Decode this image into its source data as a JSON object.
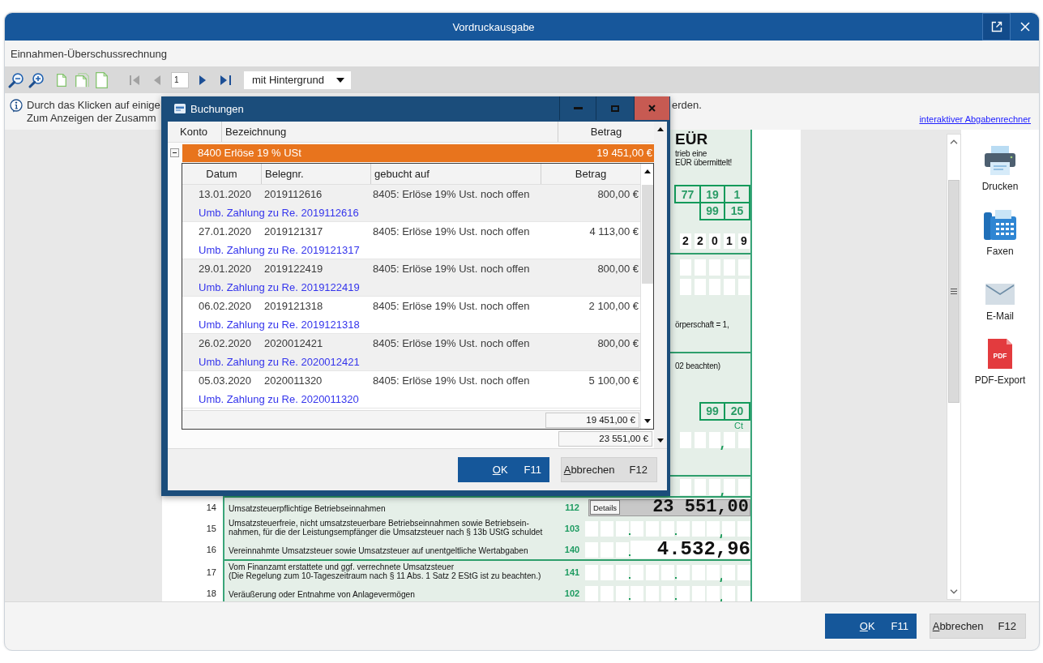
{
  "window": {
    "title": "Vordruckausgabe"
  },
  "subtitle": "Einnahmen-Überschussrechnung",
  "toolbar": {
    "nav_back": [
      {
        "kind": "first",
        "disabled": true
      },
      {
        "kind": "prev",
        "disabled": true
      }
    ],
    "page": "1",
    "nav_forward": [
      {
        "kind": "next",
        "disabled": false
      },
      {
        "kind": "last",
        "disabled": false
      }
    ],
    "view_mode": "mit Hintergrund"
  },
  "info": {
    "lines": [
      "Durch das Klicken auf einige",
      "Zum Anzeigen der Zusamm"
    ],
    "tail": "erden.",
    "link": "interaktiver Abgabenrechner"
  },
  "form": {
    "strip": [
      {
        "kind": "heading",
        "text": "EÜR"
      },
      {
        "kind": "note",
        "lines": [
          "trieb eine",
          "EÜR übermittelt!"
        ]
      },
      {
        "kind": "code_boxes",
        "rows": [
          [
            "77",
            "19",
            "1"
          ],
          [
            "",
            "99",
            "15"
          ]
        ]
      },
      {
        "kind": "digits",
        "cells": [
          "2",
          "2",
          "0",
          "1",
          "9"
        ]
      },
      {
        "kind": "rule"
      },
      {
        "kind": "blank_cells"
      },
      {
        "kind": "blank_cells"
      },
      {
        "kind": "note",
        "lines": [
          "örperschaft = 1,"
        ]
      },
      {
        "kind": "rule"
      },
      {
        "kind": "note",
        "lines": [
          "02 beachten)"
        ]
      },
      {
        "kind": "code_boxes",
        "rows": [
          [
            "99",
            "20"
          ]
        ],
        "unit": "Ct"
      },
      {
        "kind": "amount_cells"
      },
      {
        "kind": "rule"
      },
      {
        "kind": "amount_cells"
      }
    ],
    "sections": [
      {
        "rows": [
          {
            "number": "14",
            "label": [
              "Umsatzsteuerpflichtige Betriebseinnahmen"
            ],
            "code": "112",
            "kind": "details",
            "button": "Details",
            "value": "23 551,00"
          },
          {
            "number": "15",
            "label": [
              "Umsatzsteuerfreie, nicht umsatzsteuerbare Betriebseinnahmen sowie Betriebsein-",
              "nahmen, für die der Leistungsempfänger die Umsatzsteuer nach § 13b UStG schuldet"
            ],
            "code": "103",
            "kind": "cells"
          },
          {
            "number": "16",
            "label": [
              "Vereinnahmte Umsatzsteuer sowie Umsatzsteuer auf unentgeltliche Wertabgaben"
            ],
            "code": "140",
            "kind": "cells",
            "value": "4.532,96"
          }
        ]
      },
      {
        "rows": [
          {
            "number": "17",
            "label": [
              "Vom Finanzamt erstattete und ggf. verrechnete Umsatzsteuer",
              "(Die Regelung zum 10-Tageszeitraum nach § 11 Abs. 1 Satz 2 EStG ist zu beachten.)"
            ],
            "code": "141",
            "kind": "cells"
          },
          {
            "number": "18",
            "label": [
              "Veräußerung oder Entnahme von Anlagevermögen"
            ],
            "code": "102",
            "kind": "cells"
          }
        ]
      }
    ]
  },
  "sidebar": [
    {
      "kind": "print",
      "label": "Drucken"
    },
    {
      "kind": "fax",
      "label": "Faxen"
    },
    {
      "kind": "email",
      "label": "E-Mail"
    },
    {
      "kind": "pdf",
      "label": "PDF-Export",
      "badge": "PDF"
    }
  ],
  "buttons": [
    {
      "kind": "ok",
      "label": "OK",
      "shortcut": "F11"
    },
    {
      "kind": "cancel",
      "label": "Abbrechen",
      "shortcut": "F12"
    }
  ],
  "dialog": {
    "title": "Buchungen",
    "columns": [
      "Konto",
      "Bezeichnung",
      "Betrag"
    ],
    "group": {
      "label": "8400 Erlöse 19 % USt",
      "amount": "19 451,00 €",
      "expanded": true,
      "selected": true
    },
    "table": {
      "columns": [
        "Datum",
        "Belegnr.",
        "gebucht auf",
        "Betrag"
      ],
      "rows": [
        {
          "date": "13.01.2020",
          "voucher": "2019112616",
          "account": "8405: Erlöse 19% Ust. noch offen",
          "amount": "800,00 €",
          "note": "Umb. Zahlung zu Re. 2019112616"
        },
        {
          "date": "27.01.2020",
          "voucher": "2019121317",
          "account": "8405: Erlöse 19% Ust. noch offen",
          "amount": "4 113,00 €",
          "note": "Umb. Zahlung zu Re. 2019121317"
        },
        {
          "date": "29.01.2020",
          "voucher": "2019122419",
          "account": "8405: Erlöse 19% Ust. noch offen",
          "amount": "800,00 €",
          "note": "Umb. Zahlung zu Re. 2019122419"
        },
        {
          "date": "06.02.2020",
          "voucher": "2019121318",
          "account": "8405: Erlöse 19% Ust. noch offen",
          "amount": "2 100,00 €",
          "note": "Umb. Zahlung zu Re. 2019121318"
        },
        {
          "date": "26.02.2020",
          "voucher": "2020012421",
          "account": "8405: Erlöse 19% Ust. noch offen",
          "amount": "800,00 €",
          "note": "Umb. Zahlung zu Re. 2020012421"
        },
        {
          "date": "05.03.2020",
          "voucher": "2020011320",
          "account": "8405: Erlöse 19% Ust. noch offen",
          "amount": "5 100,00 €",
          "note": "Umb. Zahlung zu Re. 2020011320"
        }
      ],
      "total": "19 451,00 €"
    },
    "total": "23 551,00 €",
    "buttons": [
      {
        "kind": "ok",
        "label": "OK",
        "shortcut": "F11"
      },
      {
        "kind": "cancel",
        "label": "Abbrechen",
        "shortcut": "F12"
      }
    ]
  }
}
